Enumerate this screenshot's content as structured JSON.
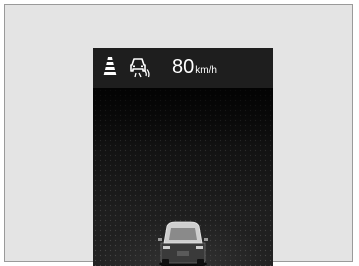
{
  "instrument_display": {
    "speed": {
      "value": "80",
      "unit": "km/h"
    },
    "icons": [
      {
        "name": "lane-keeping-assist-icon"
      },
      {
        "name": "adaptive-cruise-control-icon"
      }
    ],
    "colors": {
      "background": "#1c1c1c",
      "text": "#ffffff",
      "frame": "#e4e4e4"
    }
  }
}
